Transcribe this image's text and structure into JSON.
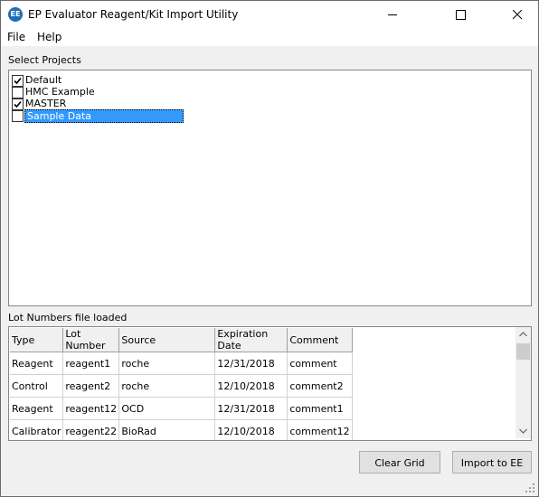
{
  "window": {
    "app_icon_text": "EE",
    "title": "EP Evaluator Reagent/Kit Import Utility"
  },
  "menu": {
    "items": [
      "File",
      "Help"
    ]
  },
  "projects": {
    "label": "Select Projects",
    "items": [
      {
        "name": "Default",
        "checked": true,
        "selected": false
      },
      {
        "name": "HMC Example",
        "checked": false,
        "selected": false
      },
      {
        "name": "MASTER",
        "checked": true,
        "selected": false
      },
      {
        "name": "Sample Data",
        "checked": false,
        "selected": true
      }
    ]
  },
  "grid": {
    "label": "Lot Numbers file loaded",
    "columns": [
      "Type",
      "Lot Number",
      "Source",
      "Expiration Date",
      "Comment"
    ],
    "rows": [
      [
        "Reagent",
        "reagent1",
        "roche",
        "12/31/2018",
        "comment"
      ],
      [
        "Control",
        "reagent2",
        "roche",
        "12/10/2018",
        "comment2"
      ],
      [
        "Reagent",
        "reagent12",
        "OCD",
        "12/31/2018",
        "comment1"
      ],
      [
        "Calibrator",
        "reagent22",
        "BioRad",
        "12/10/2018",
        "comment12"
      ]
    ]
  },
  "buttons": {
    "clear_grid": "Clear Grid",
    "import": "Import to EE"
  },
  "colors": {
    "selection": "#3399ff",
    "app_icon": "#1f6fb5"
  }
}
